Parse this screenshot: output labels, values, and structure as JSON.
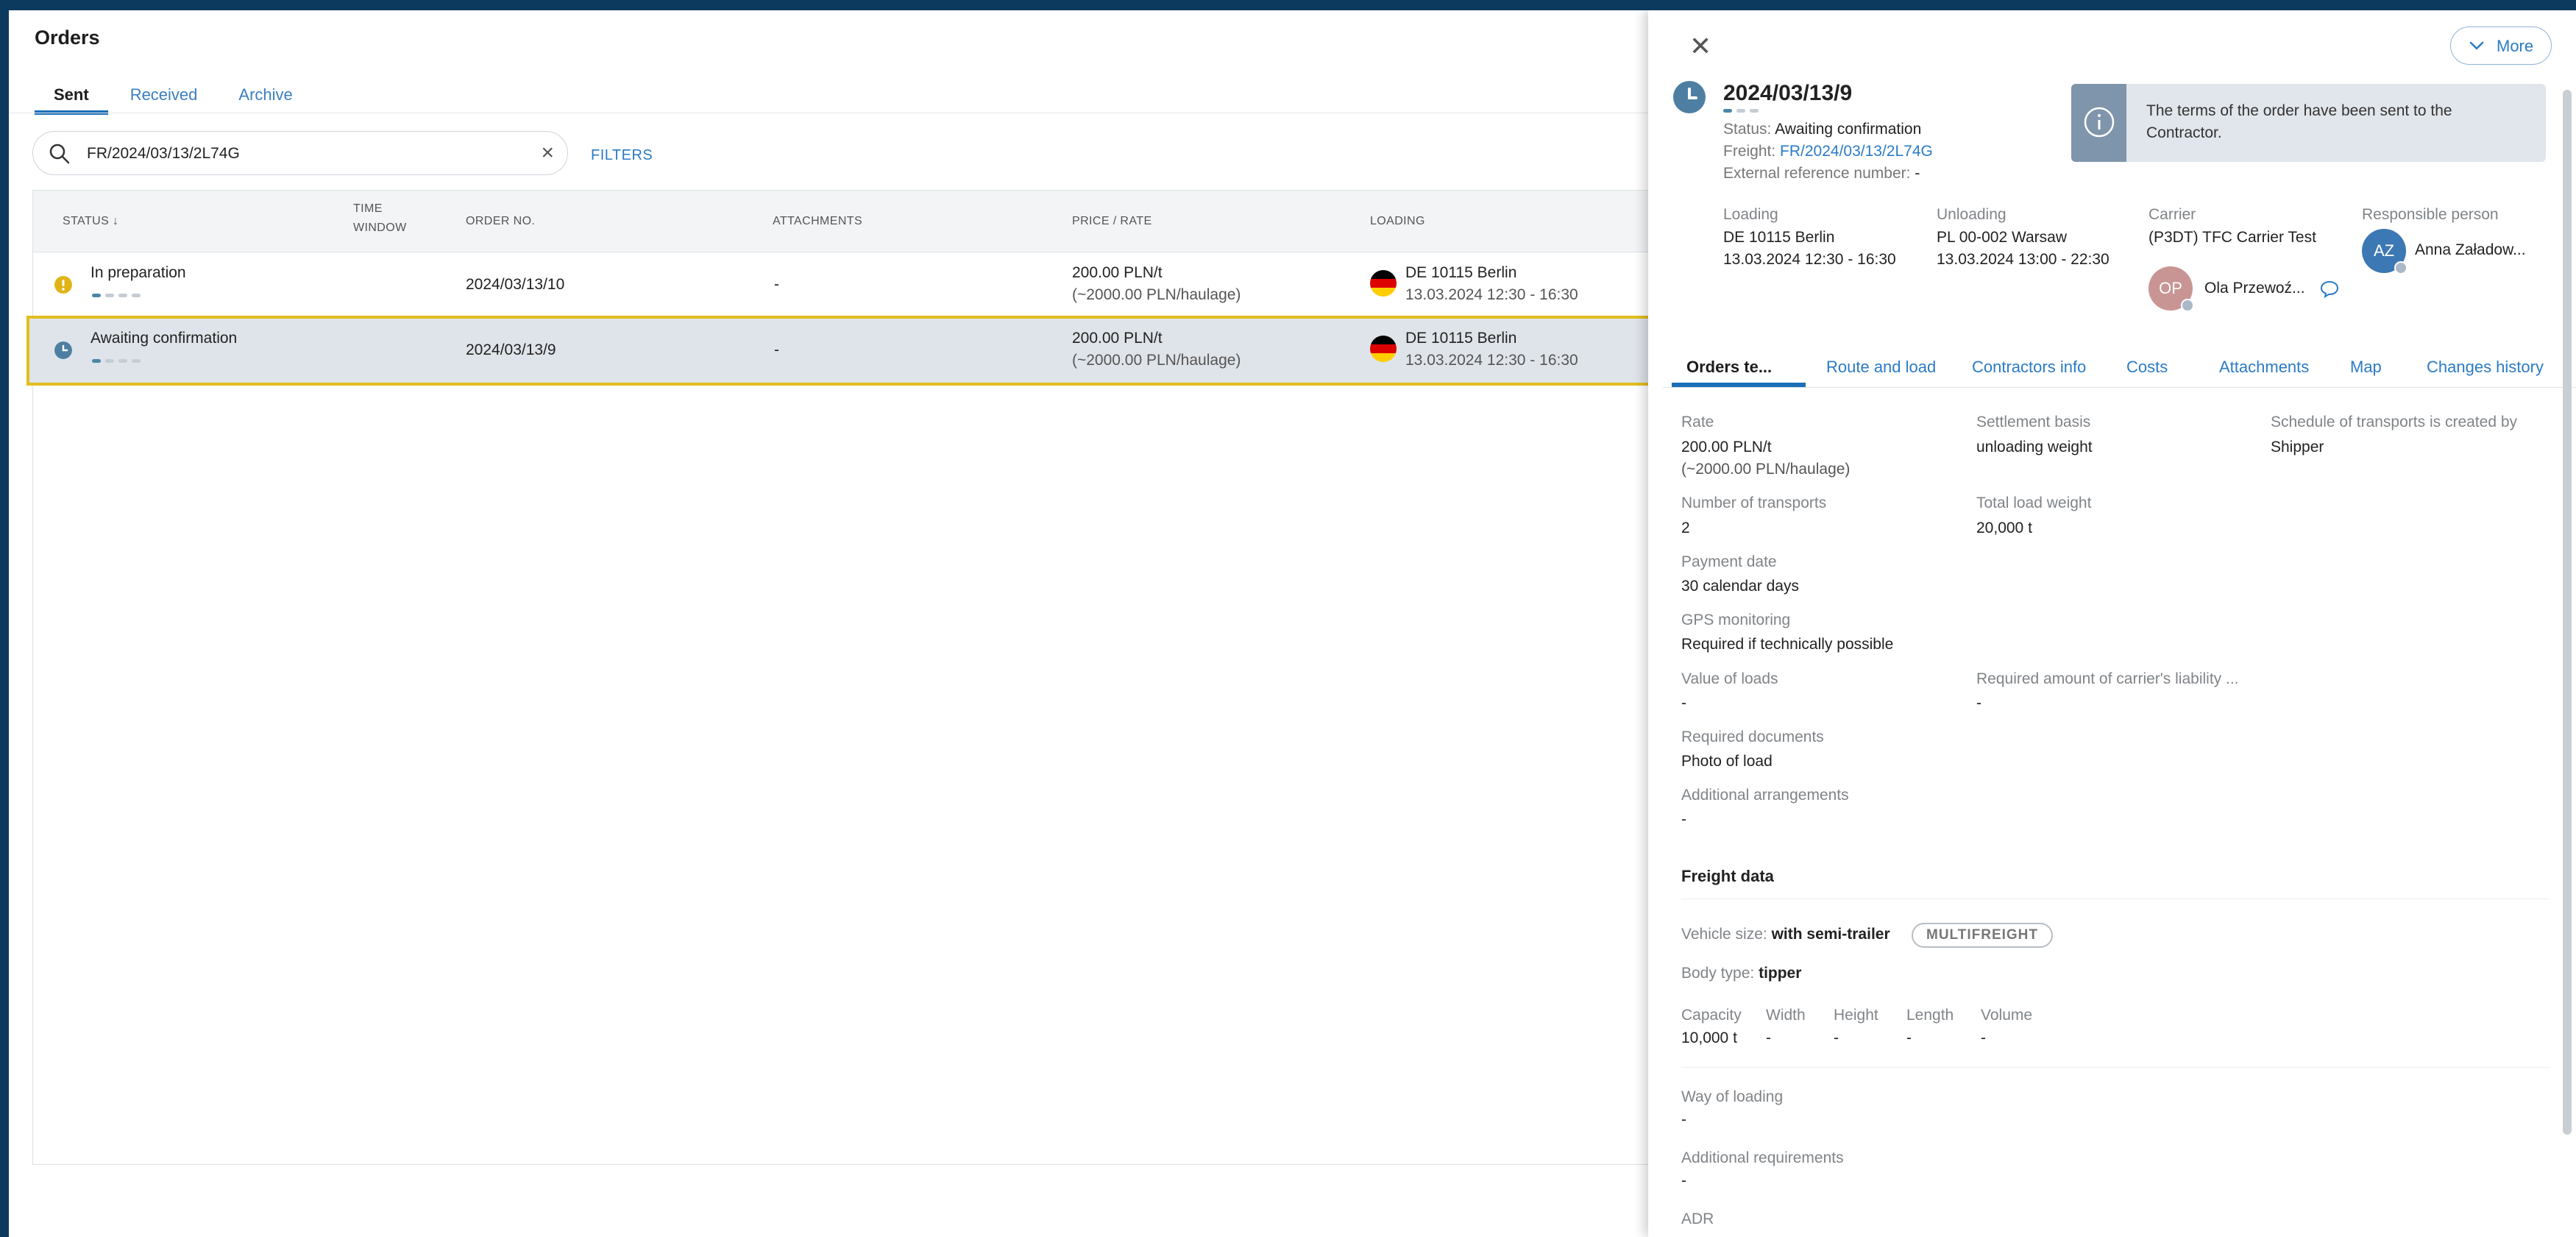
{
  "page": {
    "title": "Orders"
  },
  "tabs": [
    "Sent",
    "Received",
    "Archive"
  ],
  "search": {
    "value": "FR/2024/03/13/2L74G",
    "clear_icon": "×"
  },
  "filters_label": "FILTERS",
  "table": {
    "headers": {
      "status": "STATUS",
      "time_window_1": "TIME",
      "time_window_2": "WINDOW",
      "order_no": "ORDER NO.",
      "attachments": "ATTACHMENTS",
      "price": "PRICE / RATE",
      "loading": "LOADING"
    },
    "rows": [
      {
        "status": "In preparation",
        "status_icon": "warning-icon",
        "order_no": "2024/03/13/10",
        "attachments": "-",
        "price": "200.00 PLN/t",
        "price_sub": "(~2000.00 PLN/haulage)",
        "loading": "DE 10115 Berlin",
        "loading_time": "13.03.2024 12:30 - 16:30"
      },
      {
        "status": "Awaiting confirmation",
        "status_icon": "clock-icon",
        "order_no": "2024/03/13/9",
        "attachments": "-",
        "price": "200.00 PLN/t",
        "price_sub": "(~2000.00 PLN/haulage)",
        "loading": "DE 10115 Berlin",
        "loading_time": "13.03.2024 12:30 - 16:30"
      }
    ]
  },
  "panel": {
    "more_label": "More",
    "order_no": "2024/03/13/9",
    "status_label": "Status:",
    "status_value": "Awaiting confirmation",
    "freight_label": "Freight:",
    "freight_value": "FR/2024/03/13/2L74G",
    "ext_ref_label": "External reference number:",
    "ext_ref_value": "-",
    "info_text": "The terms of the order have been sent to the Contractor.",
    "loading_label": "Loading",
    "loading_place": "DE 10115 Berlin",
    "loading_time": "13.03.2024 12:30 - 16:30",
    "unloading_label": "Unloading",
    "unloading_place": "PL 00-002 Warsaw",
    "unloading_time": "13.03.2024 13:00 - 22:30",
    "carrier_label": "Carrier",
    "carrier_name": "(P3DT) TFC Carrier Test",
    "carrier_avatar": "OP",
    "carrier_person": "Ola Przewoź...",
    "responsible_label": "Responsible person",
    "responsible_avatar": "AZ",
    "responsible_name": "Anna Załadow...",
    "tabs": [
      "Orders te...",
      "Route and load",
      "Contractors info",
      "Costs",
      "Attachments",
      "Map",
      "Changes history"
    ],
    "terms": {
      "rate_label": "Rate",
      "rate_value": "200.00 PLN/t",
      "rate_sub": "(~2000.00 PLN/haulage)",
      "settlement_label": "Settlement basis",
      "settlement_value": "unloading weight",
      "schedule_label": "Schedule of transports is created by",
      "schedule_value": "Shipper",
      "transports_label": "Number of transports",
      "transports_value": "2",
      "total_weight_label": "Total load weight",
      "total_weight_value": "20,000 t",
      "payment_label": "Payment date",
      "payment_value": "30 calendar days",
      "gps_label": "GPS monitoring",
      "gps_value": "Required if technically possible",
      "value_loads_label": "Value of loads",
      "value_loads_value": "-",
      "liability_label": "Required amount of carrier's liability ...",
      "liability_value": "-",
      "docs_label": "Required documents",
      "docs_value": "Photo of load",
      "arrangements_label": "Additional arrangements",
      "arrangements_value": "-"
    },
    "freight": {
      "title": "Freight data",
      "vehicle_label": "Vehicle size:",
      "vehicle_value": "with semi-trailer",
      "chip": "MULTIFREIGHT",
      "body_label": "Body type:",
      "body_value": "tipper",
      "capacity_label": "Capacity",
      "capacity_value": "10,000 t",
      "width_label": "Width",
      "width_value": "-",
      "height_label": "Height",
      "height_value": "-",
      "length_label": "Length",
      "length_value": "-",
      "volume_label": "Volume",
      "volume_value": "-",
      "way_label": "Way of loading",
      "way_value": "-",
      "addreq_label": "Additional requirements",
      "addreq_value": "-",
      "adr_label": "ADR",
      "adr_value": "-"
    }
  },
  "colors": {
    "accent": "#1a6fb8",
    "link": "#2b7bc6",
    "highlight": "#e2be1e",
    "top_bar": "#0b3a5e"
  }
}
